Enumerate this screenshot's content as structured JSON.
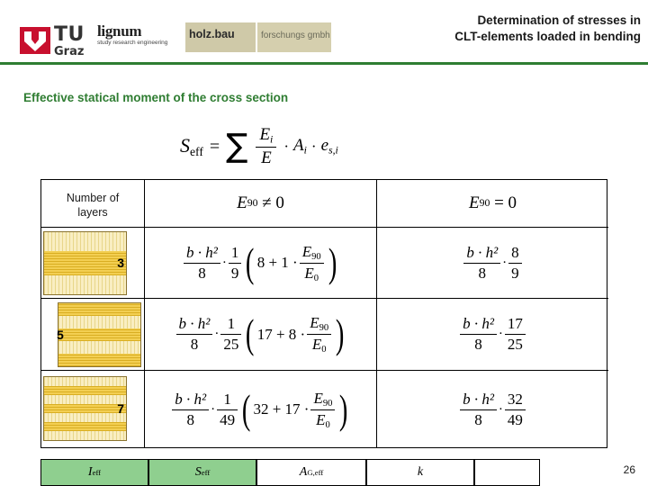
{
  "header": {
    "title_line1": "Determination of stresses in",
    "title_line2": "CLT-elements loaded in bending",
    "tu_logo": {
      "tu": "TU",
      "graz": "Graz"
    },
    "lignum": {
      "word": "lignum",
      "sub": "study  research  engineering",
      "holzbau": "holz.bau",
      "forschung": "forschungs gmbh"
    },
    "accent_color": "#2e7d32"
  },
  "section": {
    "title": "Effective statical moment of the cross section"
  },
  "formula": {
    "lhs": "S",
    "lhs_sub": "eff",
    "equals": "=",
    "sum": "∑",
    "num": "E",
    "num_sub": "i",
    "den": "E",
    "dot1": "·",
    "term2": "A",
    "term2_sub": "i",
    "dot2": "·",
    "term3": "e",
    "term3_sub": "s,i"
  },
  "table": {
    "header": {
      "col0_line1": "Number of",
      "col0_line2": "layers",
      "col1": "E",
      "col1_sub": "90",
      "col1_rel": "≠ 0",
      "col2": "E",
      "col2_sub": "90",
      "col2_rel": "= 0"
    },
    "rows": [
      {
        "layers": "3",
        "layers_align": "right",
        "col1": {
          "frac1_num": "b · h²",
          "frac1_den": "8",
          "dot": "·",
          "frac2_num": "1",
          "frac2_den": "9",
          "paren_open": "(",
          "inner_pre": "8 + 1 ·",
          "inner_frac_num": "E",
          "inner_frac_num_sub": "90",
          "inner_frac_den": "E",
          "inner_frac_den_sub": "0",
          "paren_close": ")"
        },
        "col2": {
          "frac1_num": "b · h²",
          "frac1_den": "8",
          "dot": "·",
          "frac2_num": "8",
          "frac2_den": "9"
        }
      },
      {
        "layers": "5",
        "layers_align": "left",
        "col1": {
          "frac1_num": "b · h²",
          "frac1_den": "8",
          "dot": "·",
          "frac2_num": "1",
          "frac2_den": "25",
          "paren_open": "(",
          "inner_pre": "17 + 8 ·",
          "inner_frac_num": "E",
          "inner_frac_num_sub": "90",
          "inner_frac_den": "E",
          "inner_frac_den_sub": "0",
          "paren_close": ")"
        },
        "col2": {
          "frac1_num": "b · h²",
          "frac1_den": "8",
          "dot": "·",
          "frac2_num": "17",
          "frac2_den": "25"
        }
      },
      {
        "layers": "7",
        "layers_align": "right",
        "col1": {
          "frac1_num": "b · h²",
          "frac1_den": "8",
          "dot": "·",
          "frac2_num": "1",
          "frac2_den": "49",
          "paren_open": "(",
          "inner_pre": "32 + 17 ·",
          "inner_frac_num": "E",
          "inner_frac_num_sub": "90",
          "inner_frac_den": "E",
          "inner_frac_den_sub": "0",
          "paren_close": ")"
        },
        "col2": {
          "frac1_num": "b · h²",
          "frac1_den": "8",
          "dot": "·",
          "frac2_num": "32",
          "frac2_den": "49"
        }
      }
    ]
  },
  "bottom_strip": {
    "cells": [
      {
        "label": "I",
        "sub": "eff",
        "highlight": true
      },
      {
        "label": "S",
        "sub": "eff",
        "highlight": true
      },
      {
        "label": "A",
        "sub": "G,eff",
        "highlight": false
      },
      {
        "label": "k",
        "sub": "",
        "highlight": false
      },
      {
        "label": "",
        "sub": "",
        "highlight": false
      }
    ]
  },
  "page_number": "26"
}
